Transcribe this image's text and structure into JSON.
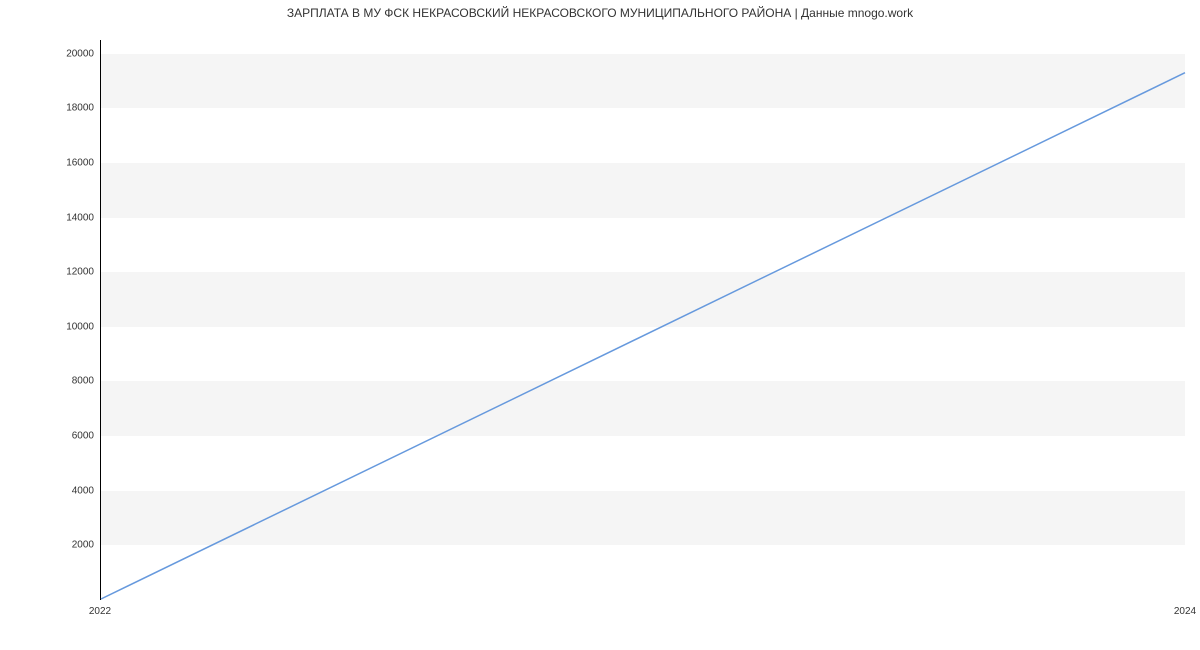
{
  "chart_data": {
    "type": "line",
    "title": "ЗАРПЛАТА В МУ ФСК НЕКРАСОВСКИЙ НЕКРАСОВСКОГО МУНИЦИПАЛЬНОГО РАЙОНА | Данные mnogo.work",
    "xlabel": "",
    "ylabel": "",
    "x": [
      2022,
      2024
    ],
    "values": [
      0,
      19300
    ],
    "xticks": [
      "2022",
      "2024"
    ],
    "yticks": [
      2000,
      4000,
      6000,
      8000,
      10000,
      12000,
      14000,
      16000,
      18000,
      20000
    ],
    "xlim": [
      2022,
      2024
    ],
    "ylim": [
      0,
      20500
    ]
  }
}
